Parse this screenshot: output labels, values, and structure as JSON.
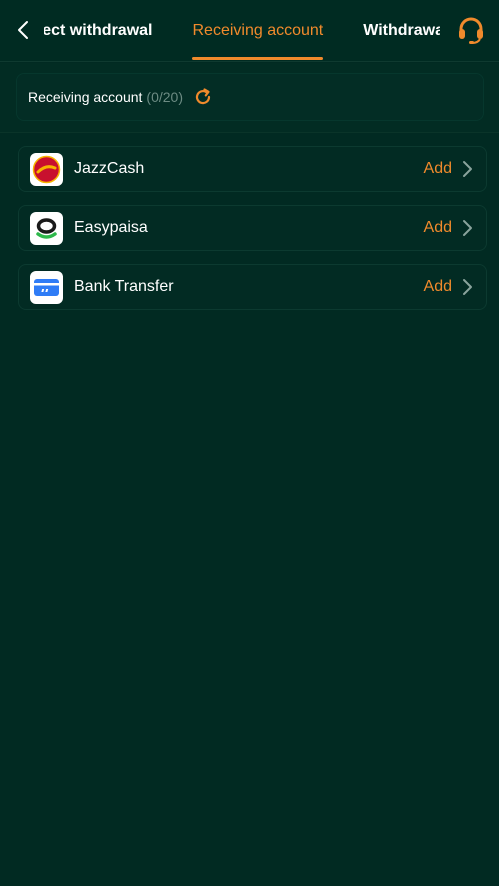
{
  "header": {
    "tabs": [
      {
        "label": "Direct withdrawal",
        "active": false
      },
      {
        "label": "Receiving account",
        "active": true
      },
      {
        "label": "Withdrawal Records",
        "active": false
      }
    ]
  },
  "summary": {
    "label": "Receiving account",
    "count": "(0/20)"
  },
  "accounts": [
    {
      "label": "JazzCash",
      "action": "Add",
      "icon": "jazzcash-logo"
    },
    {
      "label": "Easypaisa",
      "action": "Add",
      "icon": "easypaisa-logo"
    },
    {
      "label": "Bank Transfer",
      "action": "Add",
      "icon": "bank-card-icon"
    }
  ],
  "colors": {
    "background": "#012a22",
    "accent": "#f08a2c",
    "text": "#ffffff",
    "muted": "#6c8b83"
  }
}
